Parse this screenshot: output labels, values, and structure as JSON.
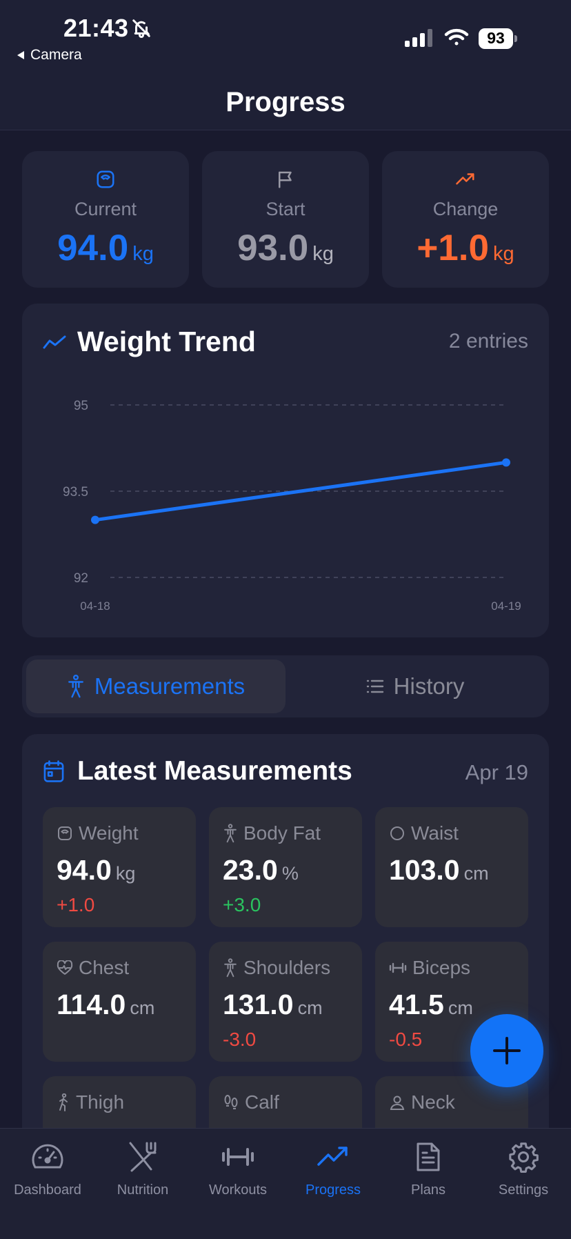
{
  "status_bar": {
    "time": "21:43",
    "back_label": "Camera",
    "battery": "93"
  },
  "header": {
    "title": "Progress"
  },
  "stats": [
    {
      "label": "Current",
      "value": "94.0",
      "unit": "kg",
      "color": "#1b73f5",
      "icon": "scale-icon"
    },
    {
      "label": "Start",
      "value": "93.0",
      "unit": "kg",
      "color": "#9a9aa6",
      "icon": "flag-icon"
    },
    {
      "label": "Change",
      "value": "+1.0",
      "unit": "kg",
      "color": "#ff6a33",
      "icon": "trend-up-icon"
    }
  ],
  "trend": {
    "title": "Weight Trend",
    "entries": "2 entries"
  },
  "chart_data": {
    "type": "line",
    "x": [
      "04-18",
      "04-19"
    ],
    "series": [
      {
        "values": [
          93.0,
          94.0
        ],
        "color": "#1b73f5"
      }
    ],
    "y_ticks": [
      "95",
      "93.5",
      "92"
    ],
    "ylim": [
      92,
      95
    ],
    "grid": true
  },
  "segments": {
    "measurements": "Measurements",
    "history": "History",
    "active": "measurements"
  },
  "measurements": {
    "title": "Latest Measurements",
    "date": "Apr 19",
    "items": [
      {
        "label": "Weight",
        "value": "94.0",
        "unit": "kg",
        "delta": "+1.0",
        "delta_color": "red",
        "icon": "scale-icon"
      },
      {
        "label": "Body Fat",
        "value": "23.0",
        "unit": "%",
        "delta": "+3.0",
        "delta_color": "green",
        "icon": "person-icon"
      },
      {
        "label": "Waist",
        "value": "103.0",
        "unit": "cm",
        "delta": "",
        "delta_color": "",
        "icon": "circle-icon"
      },
      {
        "label": "Chest",
        "value": "114.0",
        "unit": "cm",
        "delta": "",
        "delta_color": "",
        "icon": "heart-pulse-icon"
      },
      {
        "label": "Shoulders",
        "value": "131.0",
        "unit": "cm",
        "delta": "-3.0",
        "delta_color": "red",
        "icon": "person-icon"
      },
      {
        "label": "Biceps",
        "value": "41.5",
        "unit": "cm",
        "delta": "-0.5",
        "delta_color": "red",
        "icon": "dumbbell-icon"
      },
      {
        "label": "Thigh",
        "value": "",
        "unit": "",
        "delta": "",
        "delta_color": "",
        "icon": "walking-icon"
      },
      {
        "label": "Calf",
        "value": "",
        "unit": "",
        "delta": "",
        "delta_color": "",
        "icon": "footprints-icon"
      },
      {
        "label": "Neck",
        "value": "",
        "unit": "",
        "delta": "",
        "delta_color": "",
        "icon": "user-icon"
      }
    ]
  },
  "tabs": [
    {
      "label": "Dashboard",
      "icon": "gauge-icon"
    },
    {
      "label": "Nutrition",
      "icon": "utensils-icon"
    },
    {
      "label": "Workouts",
      "icon": "dumbbell-icon"
    },
    {
      "label": "Progress",
      "icon": "trend-up-icon",
      "active": true
    },
    {
      "label": "Plans",
      "icon": "document-icon"
    },
    {
      "label": "Settings",
      "icon": "gear-icon"
    }
  ]
}
